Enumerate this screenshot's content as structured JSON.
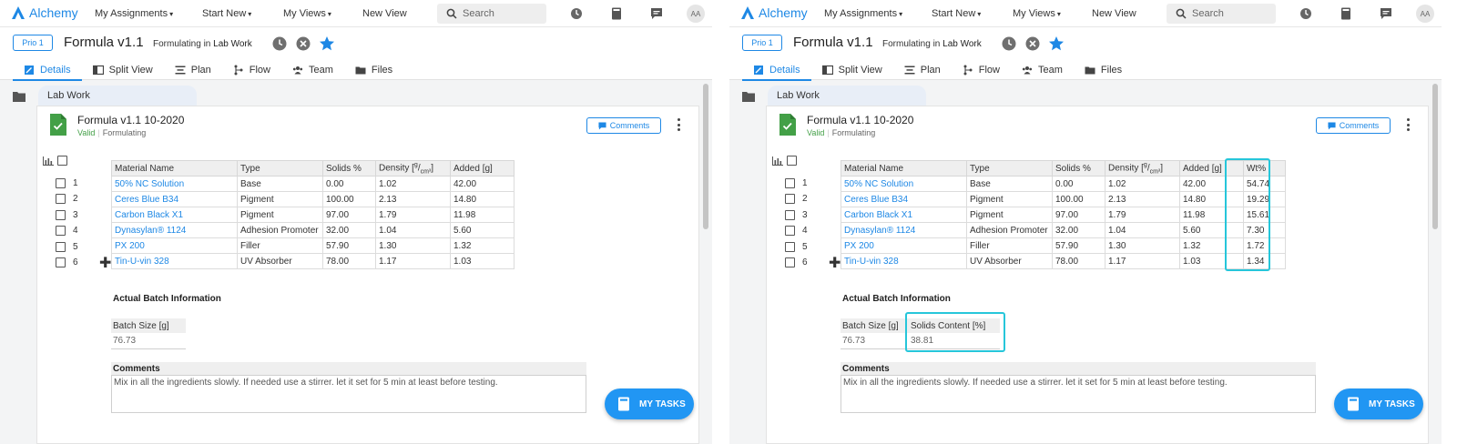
{
  "colors": {
    "accent": "#1e88e5",
    "valid": "#43a047",
    "highlight": "#26c6da",
    "fab": "#2196f3"
  },
  "nav": {
    "logo": "Alchemy",
    "items": [
      "My Assignments",
      "Start New",
      "My Views",
      "New View"
    ],
    "search_placeholder": "Search",
    "icons": [
      "clock-icon",
      "notebook-icon",
      "chat-icon"
    ],
    "avatar": "AA"
  },
  "header": {
    "prio": "Prio 1",
    "title": "Formula v1.1",
    "subtitle_prefix": "Formulating in",
    "subtitle_location": "Lab Work",
    "tabs": [
      {
        "label": "Details",
        "icon": "edit-icon"
      },
      {
        "label": "Split View",
        "icon": "split-view-icon"
      },
      {
        "label": "Plan",
        "icon": "plan-icon"
      },
      {
        "label": "Flow",
        "icon": "flow-icon"
      },
      {
        "label": "Team",
        "icon": "team-icon"
      },
      {
        "label": "Files",
        "icon": "files-icon"
      }
    ]
  },
  "content": {
    "folder_tab": "Lab Work",
    "card_title": "Formula v1.1 10-2020",
    "status_valid": "Valid",
    "status_stage": "Formulating",
    "comments_button": "Comments",
    "columns": [
      "Material Name",
      "Type",
      "Solids %",
      "Density [g/cm³]",
      "Added [g]"
    ],
    "density_parts": {
      "base": "Density [",
      "sup": "g",
      "mid": "/",
      "sub": "cm³",
      "end": "]"
    },
    "wt_column": "Wt%",
    "rows": [
      {
        "num": "1",
        "name": "50% NC Solution",
        "type": "Base",
        "solids": "0.00",
        "density": "1.02",
        "added": "42.00",
        "wt": "54.74"
      },
      {
        "num": "2",
        "name": "Ceres Blue B34",
        "type": "Pigment",
        "solids": "100.00",
        "density": "2.13",
        "added": "14.80",
        "wt": "19.29"
      },
      {
        "num": "3",
        "name": "Carbon Black X1",
        "type": "Pigment",
        "solids": "97.00",
        "density": "1.79",
        "added": "11.98",
        "wt": "15.61"
      },
      {
        "num": "4",
        "name": "Dynasylan® 1124",
        "type": "Adhesion Promoter",
        "solids": "32.00",
        "density": "1.04",
        "added": "5.60",
        "wt": "7.30"
      },
      {
        "num": "5",
        "name": "PX 200",
        "type": "Filler",
        "solids": "57.90",
        "density": "1.30",
        "added": "1.32",
        "wt": "1.72"
      },
      {
        "num": "6",
        "name": "Tin-U-vin 328",
        "type": "UV Absorber",
        "solids": "78.00",
        "density": "1.17",
        "added": "1.03",
        "wt": "1.34"
      }
    ],
    "batch_heading": "Actual Batch Information",
    "batch_size_label": "Batch Size [g]",
    "batch_size_value": "76.73",
    "solids_content_label": "Solids Content [%]",
    "solids_content_value": "38.81",
    "comments_label": "Comments",
    "comments_text": "Mix in all the ingredients slowly. If needed use a stirrer. let it set for 5 min at least before testing.",
    "fab_label": "MY TASKS"
  }
}
